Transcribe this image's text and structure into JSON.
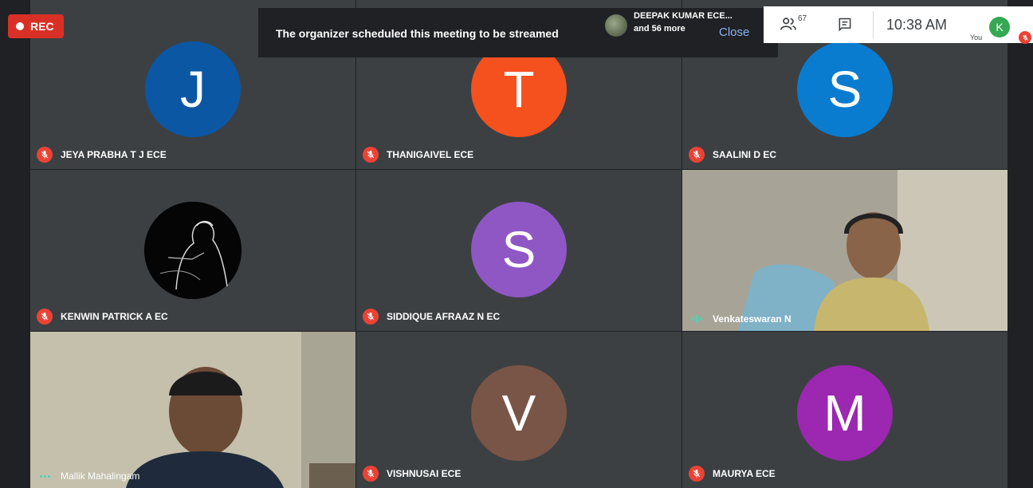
{
  "recording": {
    "label": "REC"
  },
  "banner": {
    "message": "The organizer scheduled this meeting to be streamed",
    "close_label": "Close"
  },
  "active_speaker": {
    "name": "DEEPAK KUMAR ECE...",
    "more": "and 56 more"
  },
  "controls": {
    "people_count": "67",
    "time": "10:38 AM",
    "you_label": "You",
    "self_initial": "K"
  },
  "participants": [
    {
      "name": "JEYA PRABHA T J ECE",
      "initial": "J",
      "color": "#0b57a4",
      "muted": true
    },
    {
      "name": "THANIGAIVEL ECE",
      "initial": "T",
      "color": "#f4511e",
      "muted": true
    },
    {
      "name": "SAALINI D EC",
      "initial": "S",
      "color": "#0a7ccf",
      "muted": true
    },
    {
      "name": "KENWIN PATRICK A EC",
      "initial": "",
      "color": "#000000",
      "muted": true
    },
    {
      "name": "SIDDIQUE AFRAAZ N EC",
      "initial": "S",
      "color": "#8e57c4",
      "muted": true
    },
    {
      "name": "Venkateswaran N",
      "initial": "",
      "color": "",
      "muted": false
    },
    {
      "name": "Mallik Mahalingam",
      "initial": "",
      "color": "",
      "muted": false
    },
    {
      "name": "VISHNUSAI ECE",
      "initial": "V",
      "color": "#795548",
      "muted": true
    },
    {
      "name": "MAURYA ECE",
      "initial": "M",
      "color": "#9c27b0",
      "muted": true
    }
  ]
}
